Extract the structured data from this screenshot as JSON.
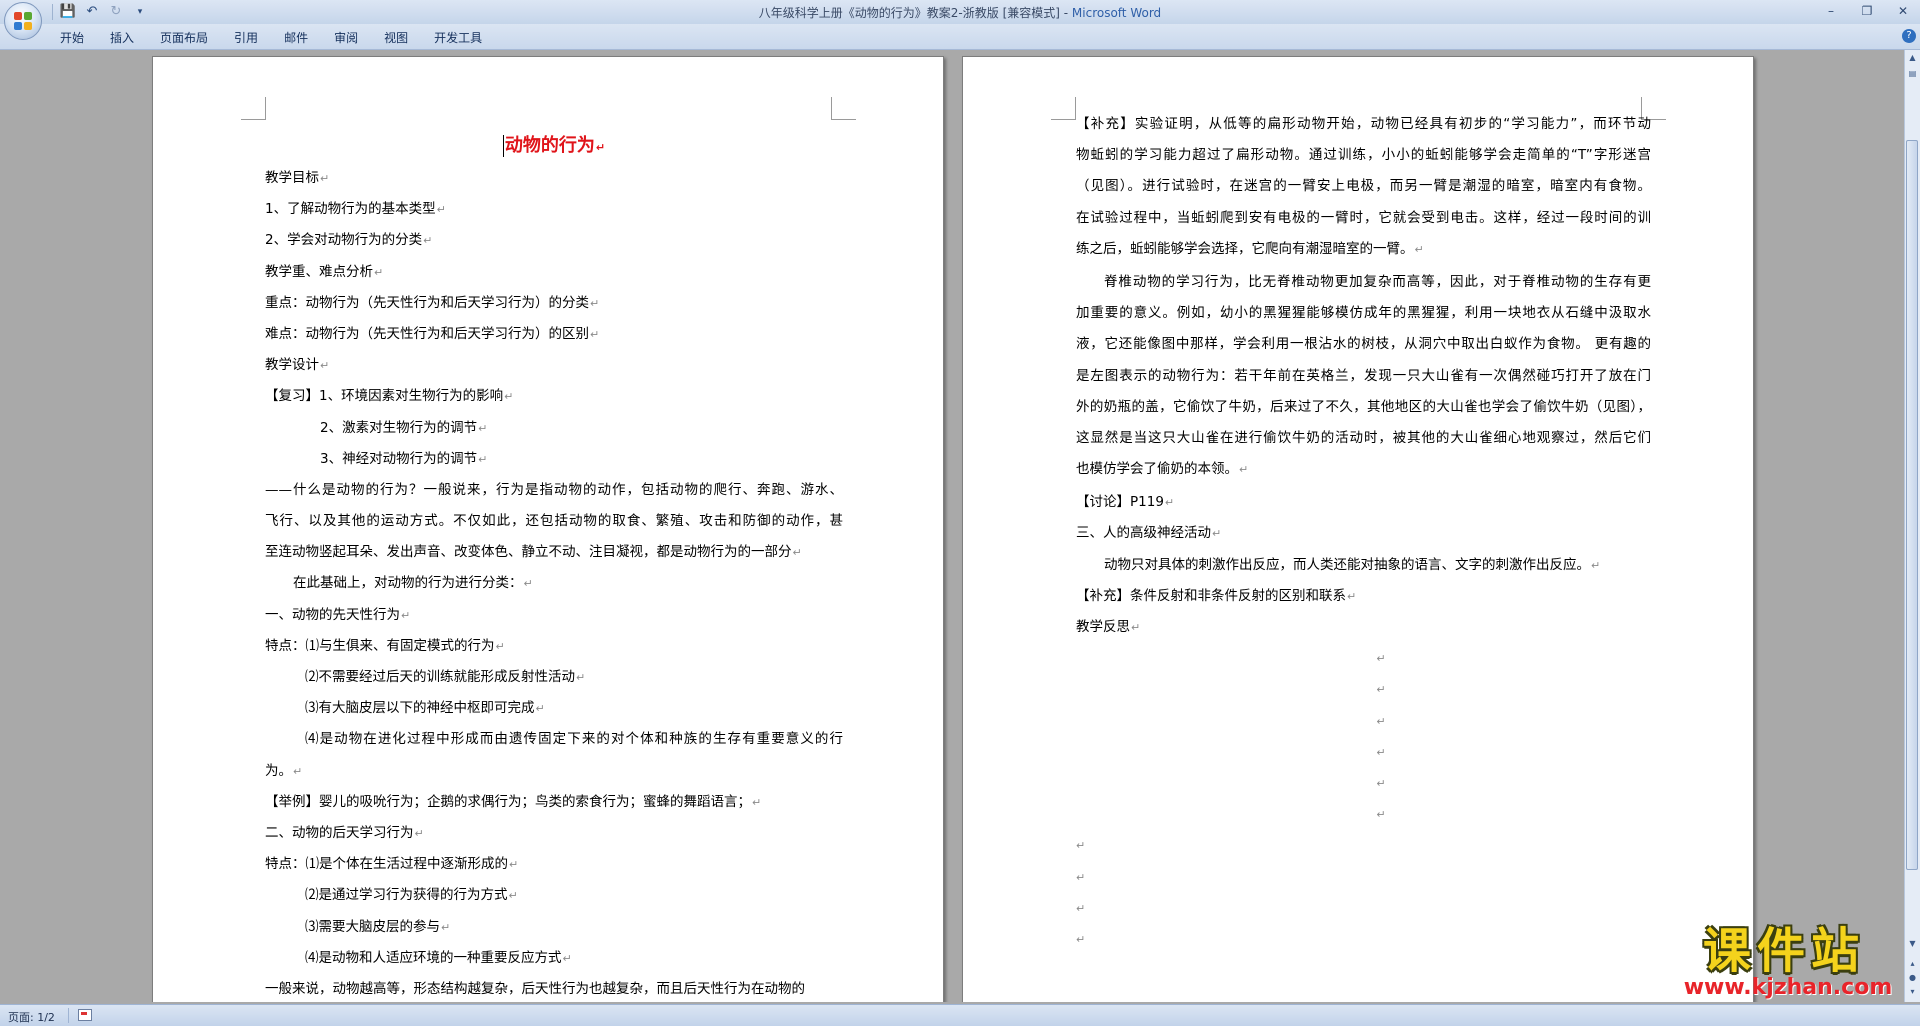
{
  "window": {
    "title": "八年级科学上册《动物的行为》教案2-浙教版 [兼容模式] - ",
    "app_name": "Microsoft Word"
  },
  "quick_access": [
    "save-icon",
    "undo-icon",
    "redo-icon",
    "customize-icon"
  ],
  "ribbon_tabs": [
    "开始",
    "插入",
    "页面布局",
    "引用",
    "邮件",
    "审阅",
    "视图",
    "开发工具"
  ],
  "status_bar": {
    "page_indicator": "页面: 1/2"
  },
  "watermark": {
    "main": "课件站",
    "url": "www.kjzhan.com"
  },
  "paragraph_mark": "↵",
  "page1": {
    "title": "动物的行为",
    "lines": [
      "教学目标",
      "1、了解动物行为的基本类型",
      "2、学会对动物行为的分类",
      "教学重、难点分析",
      "重点：动物行为（先天性行为和后天学习行为）的分类",
      "难点：动物行为（先天性行为和后天学习行为）的区别",
      "教学设计",
      "【复习】1、环境因素对生物行为的影响",
      "2、激素对生物行为的调节",
      "3、神经对动物行为的调节",
      "——什么是动物的行为？一般说来，行为是指动物的动作，包括动物的爬行、奔跑、游水、",
      "飞行、以及其他的运动方式。不仅如此，还包括动物的取食、繁殖、攻击和防御的动作，甚",
      "至连动物竖起耳朵、发出声音、改变体色、静立不动、注目凝视，都是动物行为的一部分",
      "在此基础上，对动物的行为进行分类：",
      "一、动物的先天性行为",
      "特点：⑴与生俱来、有固定模式的行为",
      "⑵不需要经过后天的训练就能形成反射性活动",
      "⑶有大脑皮层以下的神经中枢即可完成",
      "⑷是动物在进化过程中形成而由遗传固定下来的对个体和种族的生存有重要意义的行",
      "为。",
      "【举例】婴儿的吸吮行为；企鹅的求偶行为；鸟类的索食行为；蜜蜂的舞蹈语言；",
      "二、动物的后天学习行为",
      "特点：⑴是个体在生活过程中逐渐形成的",
      "⑵是通过学习行为获得的行为方式",
      "⑶需要大脑皮层的参与",
      "⑷是动物和人适应环境的一种重要反应方式",
      "一般来说，动物越高等，形态结构越复杂，后天性行为也越复杂，而且后天性行为在动物的"
    ]
  },
  "page2": {
    "lines": [
      "【补充】实验证明，从低等的扁形动物开始，动物已经具有初步的“学习能力”，而环节动",
      "物蚯蚓的学习能力超过了扁形动物。通过训练，小小的蚯蚓能够学会走简单的“T”字形迷宫",
      "（见图）。进行试验时，在迷宫的一臂安上电极，而另一臂是潮湿的暗室，暗室内有食物。",
      "在试验过程中，当蚯蚓爬到安有电极的一臂时，它就会受到电击。这样，经过一段时间的训",
      "练之后，蚯蚓能够学会选择，它爬向有潮湿暗室的一臂。",
      "脊椎动物的学习行为，比无脊椎动物更加复杂而高等，因此，对于脊椎动物的生存有更",
      "加重要的意义。例如，幼小的黑猩猩能够模仿成年的黑猩猩，利用一块地衣从石缝中汲取水",
      "液，它还能像图中那样，学会利用一根沾水的树枝，从洞穴中取出白蚁作为食物。 更有趣的",
      "是左图表示的动物行为：若干年前在英格兰，发现一只大山雀有一次偶然碰巧打开了放在门",
      "外的奶瓶的盖，它偷饮了牛奶，后来过了不久，其他地区的大山雀也学会了偷饮牛奶（见图），",
      "这显然是当这只大山雀在进行偷饮牛奶的活动时，被其他的大山雀细心地观察过，然后它们",
      "也模仿学会了偷奶的本领。",
      "【讨论】P119",
      "三、人的高级神经活动",
      "动物只对具体的刺激作出反应，而人类还能对抽象的语言、文字的刺激作出反应。",
      "【补充】条件反射和非条件反射的区别和联系",
      "教学反思"
    ]
  }
}
